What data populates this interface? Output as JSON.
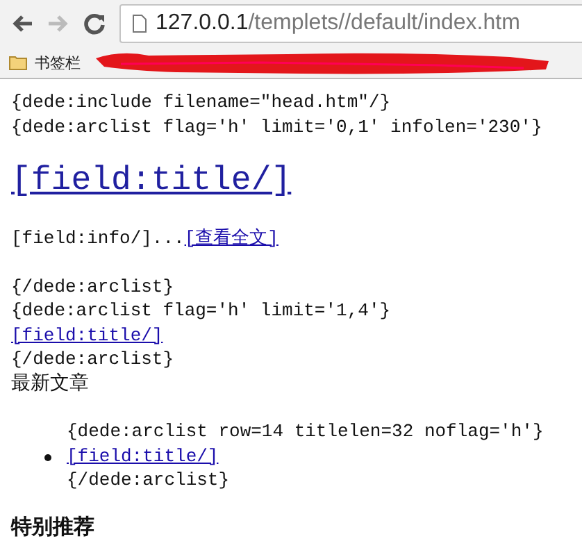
{
  "browser": {
    "url_host": "127.0.0.1",
    "url_path": "/templets//default/index.htm",
    "bookmarks_label": "书签栏"
  },
  "content": [
    {
      "kind": "code",
      "text": "{dede:include filename=\"head.htm\"/}"
    },
    {
      "kind": "code",
      "text": "{dede:arclist flag='h' limit='0,1' infolen='230'}"
    },
    {
      "kind": "title_link",
      "text": "[field:title/]"
    },
    {
      "kind": "info",
      "text": "[field:info/]...",
      "link": "[查看全文]"
    },
    {
      "kind": "code",
      "text": "{/dede:arclist}"
    },
    {
      "kind": "code",
      "text": "{dede:arclist flag='h' limit='1,4'}"
    },
    {
      "kind": "link",
      "text": "[field:title/]"
    },
    {
      "kind": "code",
      "text": "{/dede:arclist}"
    },
    {
      "kind": "label",
      "text": "最新文章"
    },
    {
      "kind": "list",
      "items": [
        {
          "kind": "code",
          "text": "{dede:arclist row=14 titlelen=32 noflag='h'}"
        },
        {
          "kind": "bullet_link",
          "text": "[field:title/]"
        },
        {
          "kind": "code",
          "text": "{/dede:arclist}"
        }
      ]
    },
    {
      "kind": "heading",
      "text": "特别推荐"
    }
  ]
}
